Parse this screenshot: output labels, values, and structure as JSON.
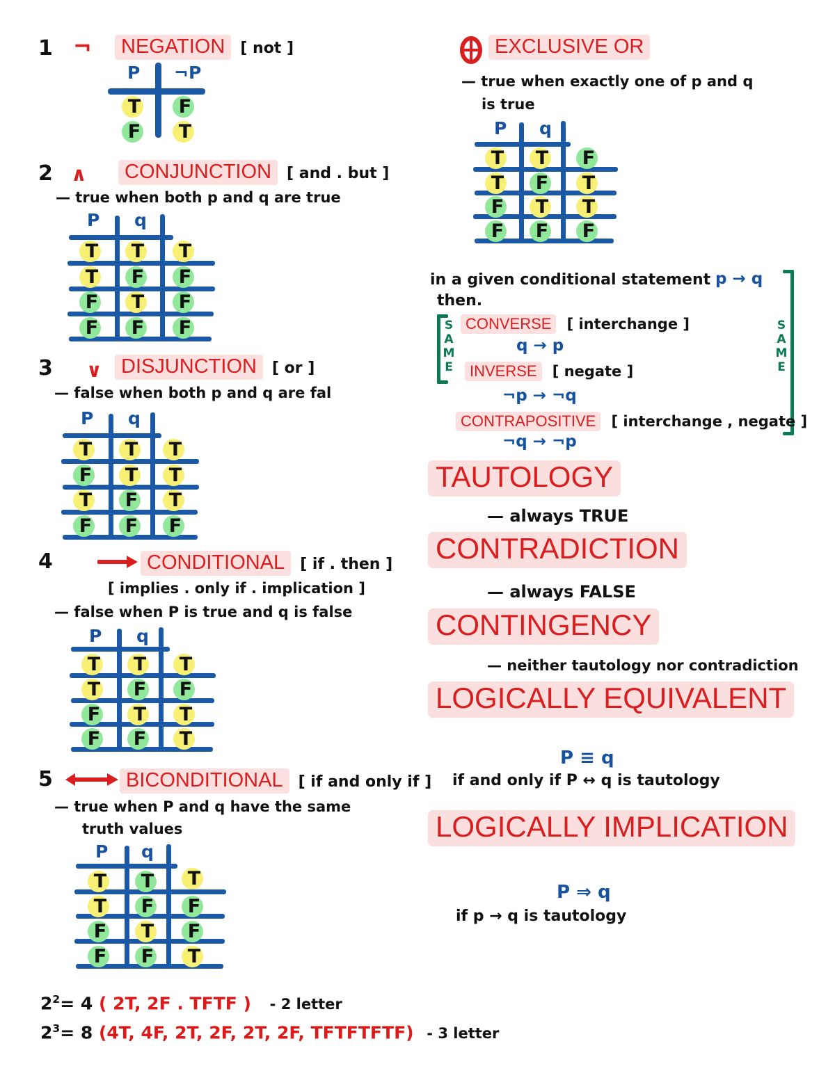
{
  "left_column": {
    "sections": [
      {
        "index": "1",
        "operator_symbol": "¬",
        "title": "NEGATION",
        "aliases": "[ not ]",
        "description": "",
        "table": {
          "headers": [
            "P",
            "¬P"
          ],
          "rows": [
            [
              "T",
              "F"
            ],
            [
              "F",
              "T"
            ]
          ]
        }
      },
      {
        "index": "2",
        "operator_symbol": "∧",
        "title": "CONJUNCTION",
        "aliases": "[ and . but ]",
        "description": "— true when both p and q are true",
        "table": {
          "headers": [
            "P",
            "q",
            ""
          ],
          "rows": [
            [
              "T",
              "T",
              "T"
            ],
            [
              "T",
              "F",
              "F"
            ],
            [
              "F",
              "T",
              "F"
            ],
            [
              "F",
              "F",
              "F"
            ]
          ]
        }
      },
      {
        "index": "3",
        "operator_symbol": "∨",
        "title": "DISJUNCTION",
        "aliases": "[ or ]",
        "description": "— false when both p and q are fal",
        "table": {
          "headers": [
            "P",
            "q",
            ""
          ],
          "rows": [
            [
              "T",
              "T",
              "T"
            ],
            [
              "F",
              "T",
              "T"
            ],
            [
              "T",
              "F",
              "T"
            ],
            [
              "F",
              "F",
              "F"
            ]
          ]
        }
      },
      {
        "index": "4",
        "operator_symbol": "→",
        "title": "CONDITIONAL",
        "aliases": "[ if . then ]",
        "aliases2": "[ implies . only if . implication ]",
        "description": "— false when P is true and q is false",
        "table": {
          "headers": [
            "P",
            "q",
            ""
          ],
          "rows": [
            [
              "T",
              "T",
              "T"
            ],
            [
              "T",
              "F",
              "F"
            ],
            [
              "F",
              "T",
              "T"
            ],
            [
              "F",
              "F",
              "T"
            ]
          ]
        }
      },
      {
        "index": "5",
        "operator_symbol": "↔",
        "title": "BICONDITIONAL",
        "aliases": "[ if and only if ]",
        "description": "— true when P and q have the same",
        "description2": "truth values",
        "table": {
          "headers": [
            "P",
            "q",
            ""
          ],
          "rows": [
            [
              "T",
              "T",
              "T"
            ],
            [
              "T",
              "F",
              "F"
            ],
            [
              "F",
              "T",
              "F"
            ],
            [
              "F",
              "F",
              "T"
            ]
          ]
        }
      }
    ]
  },
  "right_column": {
    "xor": {
      "operator_symbol": "⊕",
      "title": "EXCLUSIVE OR",
      "description_line1": "— true  when exactly  one of  p  and q",
      "description_line2": "is true",
      "table": {
        "headers": [
          "P",
          "q",
          ""
        ],
        "rows": [
          [
            "T",
            "T",
            "F"
          ],
          [
            "T",
            "F",
            "T"
          ],
          [
            "F",
            "T",
            "T"
          ],
          [
            "F",
            "F",
            "F"
          ]
        ]
      }
    },
    "conditional_variants": {
      "intro_line1": "in a given conditional statement",
      "intro_formula": "p → q",
      "intro_line2": "then.",
      "bracket_label": "SAME",
      "items": [
        {
          "title": "CONVERSE",
          "note": "[ interchange ]",
          "formula": "q → p"
        },
        {
          "title": "INVERSE",
          "note": "[ negate ]",
          "formula": "¬p → ¬q"
        },
        {
          "title": "CONTRAPOSITIVE",
          "note": "[ interchange , negate ]",
          "formula": "¬q → ¬p"
        }
      ]
    },
    "definitions": [
      {
        "title": "TAUTOLOGY",
        "note": "— always   TRUE"
      },
      {
        "title": "CONTRADICTION",
        "note": "— always FALSE"
      },
      {
        "title": "CONTINGENCY",
        "note": "— neither  tautology  nor contradiction"
      }
    ],
    "logically_equivalent": {
      "title": "LOGICALLY EQUIVALENT",
      "formula": "P ≡ q",
      "note": "if and only if   P ↔ q  is  tautology"
    },
    "logical_implication": {
      "title": "LOGICALLY IMPLICATION",
      "formula": "P ⇒ q",
      "note": "if p → q  is  tautology"
    }
  },
  "footer": {
    "line1_exp_base": "2",
    "line1_exp": "2",
    "line1_eq": "= 4",
    "line1_red": "( 2T, 2F . TFTF )",
    "line1_tail": "- 2 letter",
    "line2_exp_base": "2",
    "line2_exp": "3",
    "line2_eq": "= 8",
    "line2_red": "(4T, 4F, 2T, 2F, 2T, 2F, TFTFTFTF)",
    "line2_tail": "- 3 letter"
  },
  "colors": {
    "accent_red": "#D81E1E",
    "highlight_pink": "#FCE0E0",
    "grid_blue": "#1B59A6",
    "text_blue": "#17529E",
    "true_chip": "#F7F075",
    "false_chip": "#92E89A",
    "same_green": "#0B7A52"
  }
}
